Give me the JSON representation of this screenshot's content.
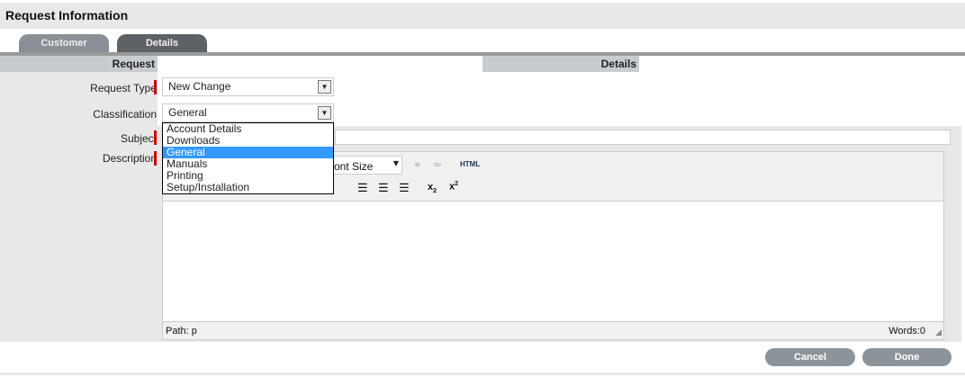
{
  "page": {
    "title": "Request Information"
  },
  "tabs": [
    {
      "label": "Customer",
      "active": false
    },
    {
      "label": "Details",
      "active": true
    }
  ],
  "sections": {
    "request": "Request",
    "details": "Details"
  },
  "form": {
    "request_type": {
      "label": "Request Type",
      "value": "New Change"
    },
    "classification": {
      "label": "Classification",
      "value": "General",
      "options": [
        "Account Details",
        "Downloads",
        "General",
        "Manuals",
        "Printing",
        "Setup/Installation"
      ],
      "highlighted": "General"
    },
    "subject": {
      "label": "Subject",
      "value": ""
    },
    "description": {
      "label": "Description"
    }
  },
  "editor": {
    "font_size_label": "Font Size",
    "font_size_visible": "ont Size",
    "html_label": "HTML",
    "path": "Path: p",
    "words": "Words:0"
  },
  "buttons": {
    "cancel": "Cancel",
    "done": "Done"
  },
  "colors": {
    "required": "#cc0000",
    "highlight": "#3399ff",
    "button": "#8c9399"
  }
}
